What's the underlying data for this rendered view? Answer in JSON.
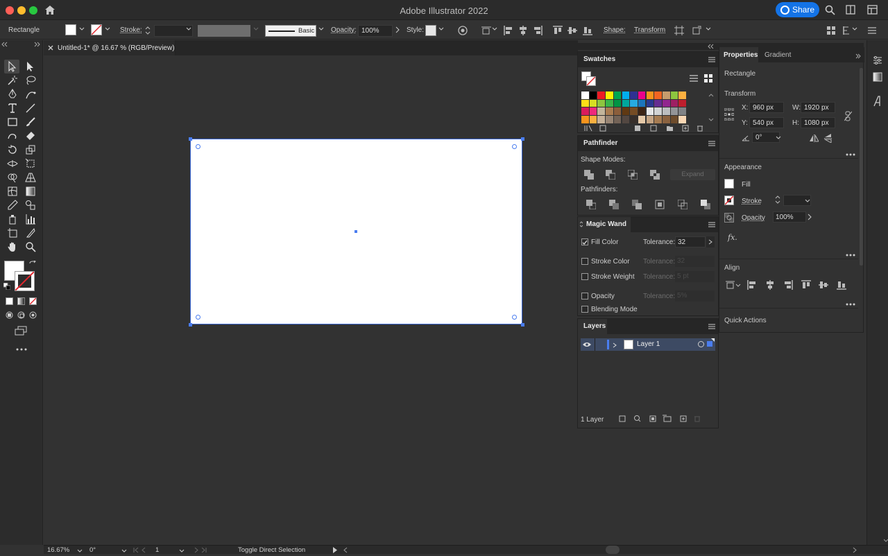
{
  "window": {
    "title": "Adobe Illustrator 2022",
    "share_label": "Share",
    "traffic_colors": [
      "#fe5f57",
      "#febc2e",
      "#28c840"
    ]
  },
  "controlbar": {
    "object_type": "Rectangle",
    "stroke_label": "Stroke:",
    "brush_label": "Basic",
    "opacity_label": "Opacity:",
    "opacity_value": "100%",
    "style_label": "Style:",
    "shape_label": "Shape:",
    "transform_label": "Transform"
  },
  "document": {
    "tab_label": "Untitled-1* @ 16.67 % (RGB/Preview)"
  },
  "swatches": {
    "title": "Swatches",
    "colors": [
      "#ffffff",
      "#000000",
      "#ed1c24",
      "#fff200",
      "#00a651",
      "#00aeef",
      "#2e3192",
      "#ec008c",
      "#f7941d",
      "#f26522",
      "#c69c6d",
      "#8dc63f",
      "#fbb040",
      "#ffde17",
      "#d7df23",
      "#8dc63f",
      "#39b54a",
      "#009444",
      "#00a79d",
      "#27aae1",
      "#1c75bc",
      "#2b388f",
      "#662d91",
      "#92278f",
      "#9e1f63",
      "#be1e2d",
      "#da1c5c",
      "#ee2a7b",
      "#c2b59b",
      "#a97c50",
      "#8b5e3c",
      "#603913",
      "#754c24",
      "#3c2415",
      "#e6e7e8",
      "#d1d3d4",
      "#bcbec0",
      "#939598",
      "#808285",
      "#f7941d",
      "#fbb040",
      "#c7b299",
      "#998675",
      "#736357",
      "#534741",
      "#372f2b",
      "#e5c9a8",
      "#c4a484",
      "#a67c52",
      "#8b6340",
      "#6d4c2c",
      "#f9d7b4"
    ]
  },
  "pathfinder": {
    "title": "Pathfinder",
    "shape_modes_label": "Shape Modes:",
    "expand_label": "Expand",
    "pathfinders_label": "Pathfinders:"
  },
  "magic_wand": {
    "title": "Magic Wand",
    "rows": [
      {
        "label": "Fill Color",
        "tolerance_label": "Tolerance:",
        "value": "32",
        "checked": true,
        "enabled": true
      },
      {
        "label": "Stroke Color",
        "tolerance_label": "Tolerance:",
        "value": "32",
        "checked": false,
        "enabled": false
      },
      {
        "label": "Stroke Weight",
        "tolerance_label": "Tolerance:",
        "value": "5 pt",
        "checked": false,
        "enabled": false
      },
      {
        "label": "Opacity",
        "tolerance_label": "Tolerance:",
        "value": "5%",
        "checked": false,
        "enabled": false
      },
      {
        "label": "Blending Mode",
        "checked": false,
        "enabled": true
      }
    ]
  },
  "layers": {
    "title": "Layers",
    "layer_name": "Layer 1",
    "count_label": "1 Layer"
  },
  "properties": {
    "tab_properties": "Properties",
    "tab_gradient": "Gradient",
    "object_type": "Rectangle",
    "transform_label": "Transform",
    "x_label": "X:",
    "x_value": "960 px",
    "w_label": "W:",
    "w_value": "1920 px",
    "y_label": "Y:",
    "y_value": "540 px",
    "h_label": "H:",
    "h_value": "1080 px",
    "angle_value": "0°",
    "appearance_label": "Appearance",
    "fill_label": "Fill",
    "stroke_label": "Stroke",
    "opacity_label": "Opacity",
    "opacity_value": "100%",
    "fx_label": "fx.",
    "align_label": "Align",
    "quick_actions_label": "Quick Actions"
  },
  "statusbar": {
    "zoom": "16.67%",
    "rotation": "0°",
    "artboard": "1",
    "tool_hint": "Toggle Direct Selection"
  },
  "colors": {
    "accent": "#1473e6",
    "selection": "#4a7df0"
  }
}
